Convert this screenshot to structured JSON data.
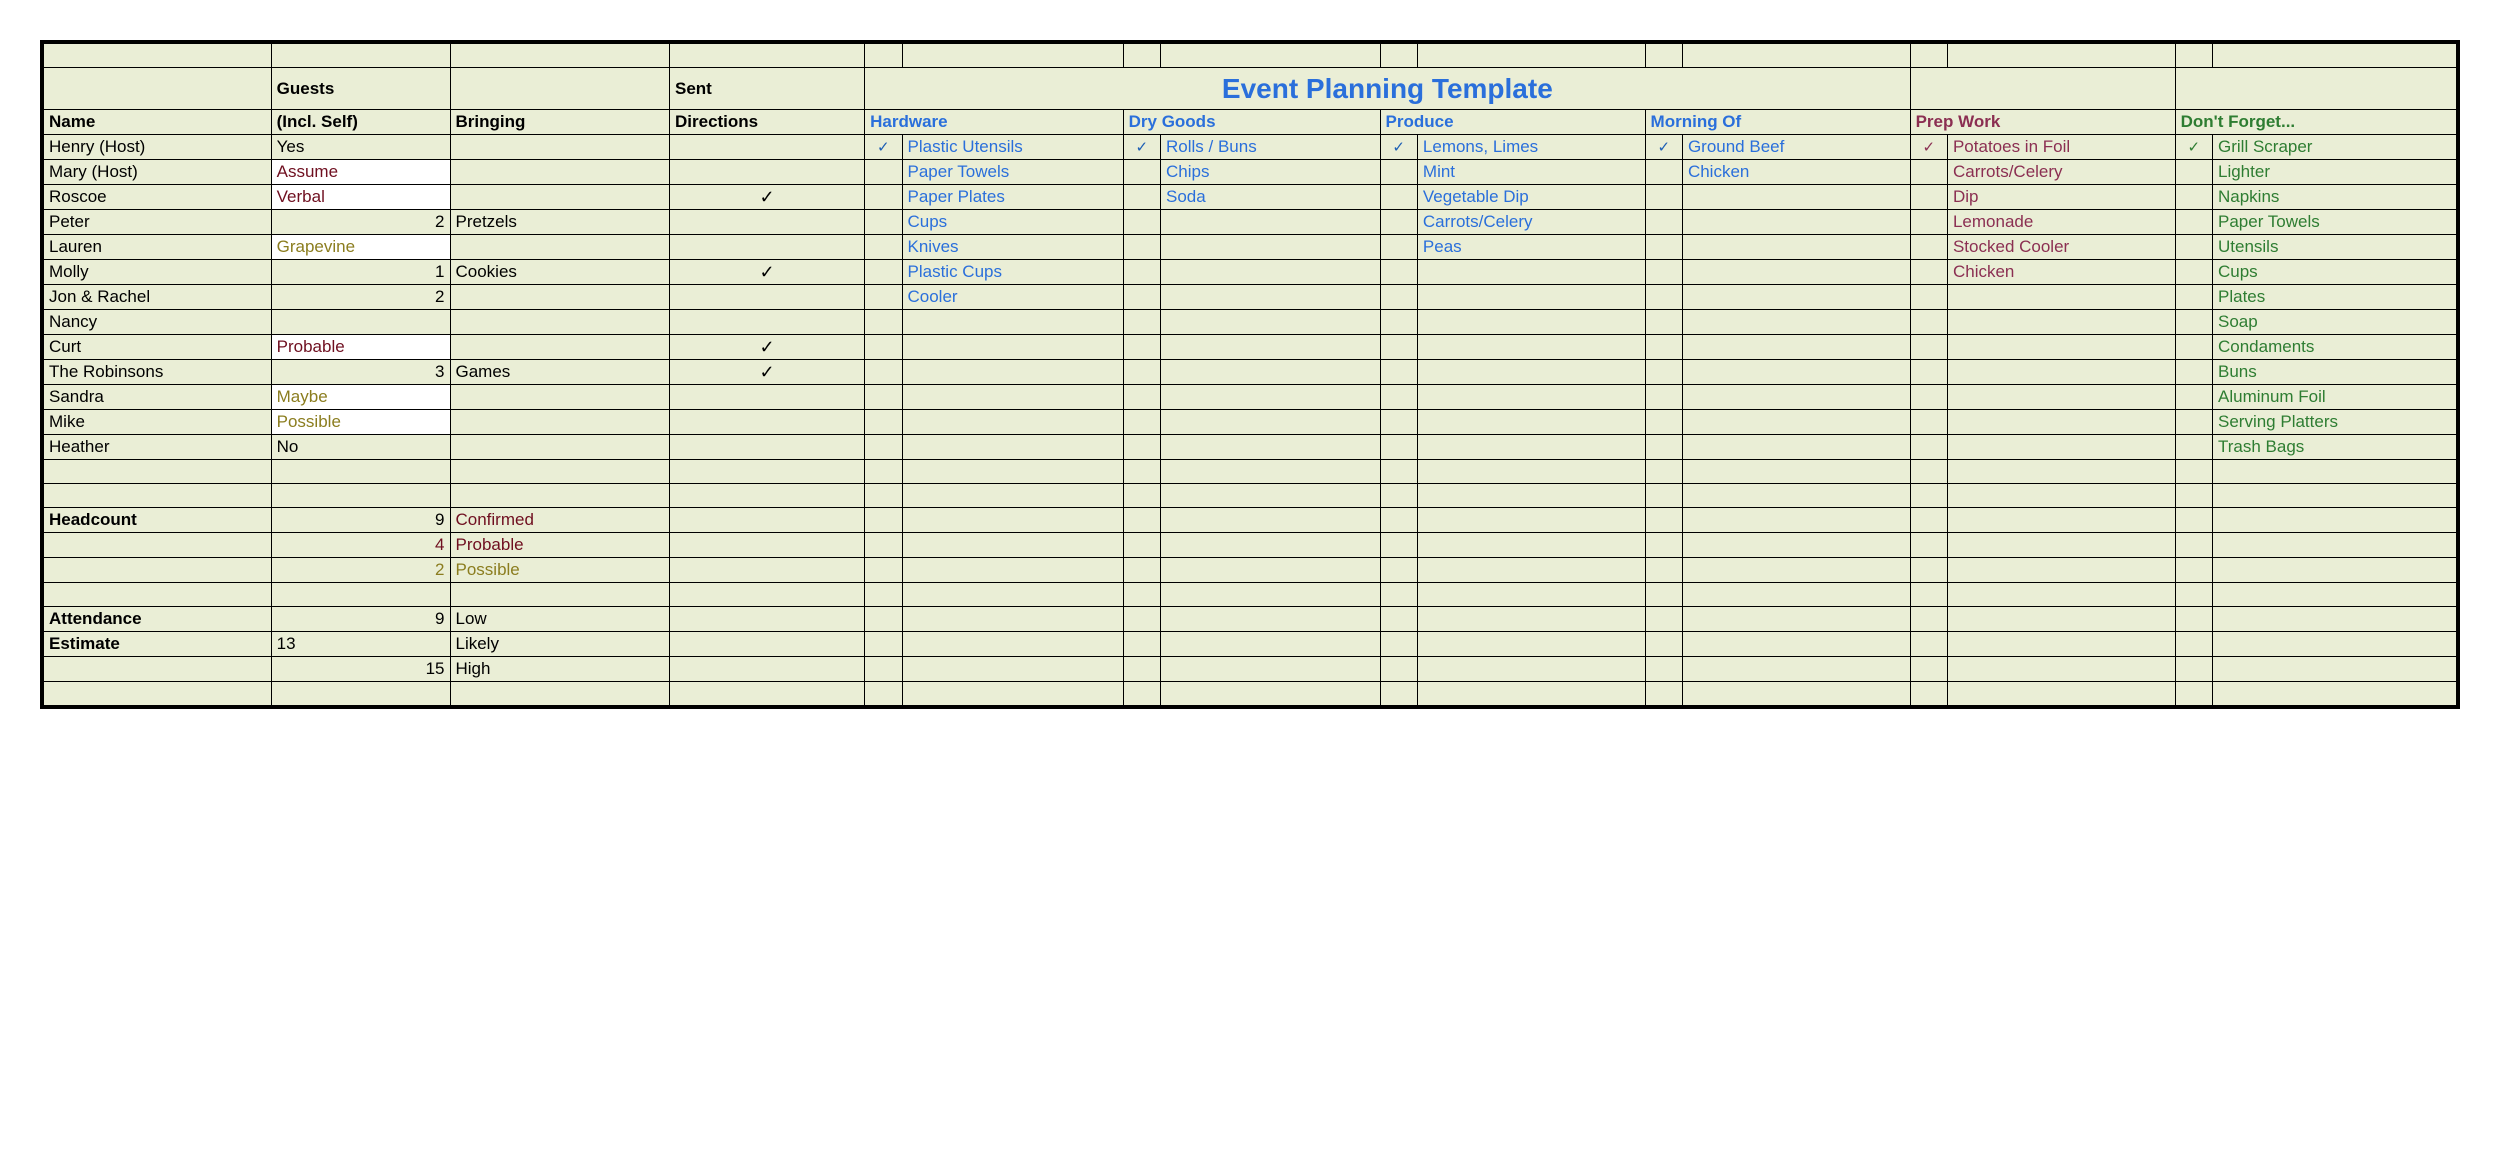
{
  "title": "Event Planning Template",
  "headers": {
    "guests": "Guests",
    "sent": "Sent",
    "name": "Name",
    "incl": "(Incl. Self)",
    "bringing": "Bringing",
    "directions": "Directions",
    "hardware": "Hardware",
    "drygoods": "Dry Goods",
    "produce": "Produce",
    "morning": "Morning Of",
    "prep": "Prep Work",
    "dontforget": "Don't Forget..."
  },
  "check": "✓",
  "guests": [
    {
      "name": "Henry (Host)",
      "incl": "Yes",
      "incl_class": "",
      "bringing": "",
      "dir": ""
    },
    {
      "name": "Mary (Host)",
      "incl": "Assume",
      "incl_class": "txt-dkred whitebg",
      "bringing": "",
      "dir": ""
    },
    {
      "name": "Roscoe",
      "incl": "Verbal",
      "incl_class": "txt-dkred whitebg",
      "bringing": "",
      "dir": "✓"
    },
    {
      "name": "Peter",
      "incl": "2",
      "incl_class": "num",
      "bringing": "Pretzels",
      "dir": ""
    },
    {
      "name": "Lauren",
      "incl": "Grapevine",
      "incl_class": "txt-olive whitebg",
      "bringing": "",
      "dir": ""
    },
    {
      "name": "Molly",
      "incl": "1",
      "incl_class": "num",
      "bringing": "Cookies",
      "dir": "✓"
    },
    {
      "name": "Jon & Rachel",
      "incl": "2",
      "incl_class": "num",
      "bringing": "",
      "dir": ""
    },
    {
      "name": "Nancy",
      "incl": "",
      "incl_class": "",
      "bringing": "",
      "dir": ""
    },
    {
      "name": "Curt",
      "incl": "Probable",
      "incl_class": "txt-dkred whitebg",
      "bringing": "",
      "dir": "✓"
    },
    {
      "name": "The Robinsons",
      "incl": "3",
      "incl_class": "num",
      "bringing": "Games",
      "dir": "✓"
    },
    {
      "name": "Sandra",
      "incl": "Maybe",
      "incl_class": "txt-olive whitebg",
      "bringing": "",
      "dir": ""
    },
    {
      "name": "Mike",
      "incl": "Possible",
      "incl_class": "txt-olive whitebg",
      "bringing": "",
      "dir": ""
    },
    {
      "name": "Heather",
      "incl": "No",
      "incl_class": "",
      "bringing": "",
      "dir": ""
    }
  ],
  "lists": {
    "hardware": [
      "Plastic Utensils",
      "Paper Towels",
      "Paper Plates",
      "Cups",
      "Knives",
      "Plastic Cups",
      "Cooler"
    ],
    "drygoods": [
      "Rolls / Buns",
      "Chips",
      "Soda"
    ],
    "produce": [
      "Lemons, Limes",
      "Mint",
      "Vegetable Dip",
      "Carrots/Celery",
      "Peas"
    ],
    "morning": [
      "Ground Beef",
      "Chicken"
    ],
    "prep": [
      "Potatoes in Foil",
      "Carrots/Celery",
      "Dip",
      "Lemonade",
      "Stocked Cooler",
      "Chicken"
    ],
    "dontforget": [
      "Grill Scraper",
      "Lighter",
      "Napkins",
      "Paper Towels",
      "Utensils",
      "Cups",
      "Plates",
      "Soap",
      "Condaments",
      "Buns",
      "Aluminum Foil",
      "Serving Platters",
      "Trash Bags"
    ]
  },
  "checks_first_row": {
    "hardware": "✓",
    "drygoods": "✓",
    "produce": "✓",
    "morning": "✓",
    "prep": "✓",
    "dontforget": "✓"
  },
  "summary": {
    "headcount_label": "Headcount",
    "confirmed_n": "9",
    "confirmed": "Confirmed",
    "probable_n": "4",
    "probable": "Probable",
    "possible_n": "2",
    "possible": "Possible",
    "attendance_label": "Attendance",
    "estimate_label": "Estimate",
    "low_n": "9",
    "low": "Low",
    "likely_n": "13",
    "likely": "Likely",
    "high_n": "15",
    "high": "High"
  }
}
